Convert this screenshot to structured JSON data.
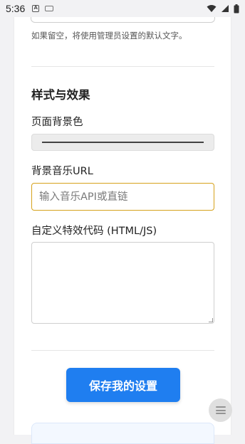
{
  "status_bar": {
    "time": "5:36"
  },
  "form": {
    "top_hint": "如果留空，将使用管理员设置的默认文字。",
    "section_title": "样式与效果",
    "bg_color": {
      "label": "页面背景色"
    },
    "bg_music": {
      "label": "背景音乐URL",
      "placeholder": "输入音乐API或直链",
      "value": ""
    },
    "custom_code": {
      "label": "自定义特效代码 (HTML/JS)",
      "value": ""
    },
    "save_button": "保存我的设置"
  },
  "colors": {
    "primary": "#1f7ef0",
    "focus_border": "#d6a21b"
  }
}
